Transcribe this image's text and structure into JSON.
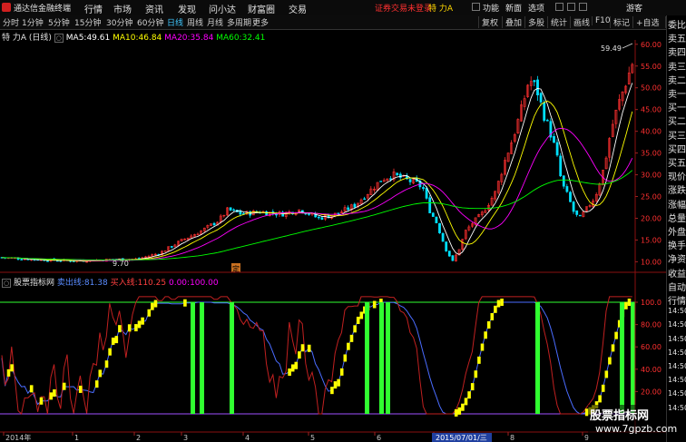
{
  "menubar": {
    "app_title": "通达信金融终端",
    "menus": [
      "行情",
      "市场",
      "资讯",
      "发现",
      "问小达",
      "财富圈",
      "交易"
    ],
    "status": "证券交易未登录",
    "stock": "特 力A",
    "right_menus": [
      "功能",
      "新面",
      "选项",
      "游客"
    ]
  },
  "toolbar": {
    "periods": [
      "分时",
      "1分钟",
      "5分钟",
      "15分钟",
      "30分钟",
      "60分钟",
      "日线",
      "周线",
      "月线",
      "多周期",
      "更多"
    ],
    "active_period": "日线",
    "right_buttons": [
      "复权",
      "叠加",
      "多股",
      "统计",
      "画线",
      "F10",
      "标记",
      "+自选",
      "返回"
    ]
  },
  "price_panel": {
    "title": "特 力A (日线)",
    "ma": [
      {
        "label": "MA5:",
        "value": "49.61",
        "color": "#ffffff"
      },
      {
        "label": "MA10:",
        "value": "46.84",
        "color": "#ffff00"
      },
      {
        "label": "MA20:",
        "value": "35.84",
        "color": "#ff00ff"
      },
      {
        "label": "MA60:",
        "value": "32.41",
        "color": "#00ff00"
      }
    ],
    "high_label": "59.49",
    "low_label": "9.70",
    "marker": "定",
    "y_ticks": [
      "60.00",
      "55.00",
      "50.00",
      "45.00",
      "40.00",
      "35.00",
      "30.00",
      "25.00",
      "20.00",
      "15.00",
      "10.00"
    ]
  },
  "indicator_panel": {
    "name": "股票指标网",
    "items": [
      {
        "label": "卖出线:",
        "value": "81.38",
        "color": "#5a8cff"
      },
      {
        "label": "买入线:",
        "value": "110.25",
        "color": "#ff4040"
      },
      {
        "label": "",
        "value": "0.00",
        "color": "#ff00ff"
      },
      {
        "label": "",
        "value": "100.00",
        "color": "#ff00ff"
      }
    ],
    "y_ticks": [
      "100.0",
      "80.00",
      "60.00",
      "40.00",
      "20.00"
    ]
  },
  "xaxis": {
    "labels": [
      "2014年",
      "1",
      "2",
      "3",
      "4",
      "5",
      "6",
      "2015/07/01/三",
      "8",
      "9"
    ]
  },
  "right_panel": {
    "tabs": [
      "委比",
      "卖五",
      "卖四",
      "卖三",
      "卖二",
      "卖一",
      "买一",
      "买二",
      "买三",
      "买四",
      "买五",
      "现价",
      "涨跌",
      "涨幅",
      "总量",
      "外盘",
      "换手",
      "净资",
      "收益",
      "自动",
      "行情",
      "14:50",
      "14:50",
      "14:50",
      "14:50",
      "14:50",
      "14:50",
      "14:50",
      "14:50"
    ]
  },
  "watermark": {
    "line1": "股票指标网",
    "line2": "www.7gpzb.com"
  },
  "chart_data": [
    {
      "type": "candlestick",
      "title": "特 力A (日线)",
      "ylim": [
        8,
        61
      ],
      "x": [
        "2014-01",
        "2014-02",
        "2014-03",
        "2014-04",
        "2014-05",
        "2014-06",
        "2015-07",
        "2015-08",
        "2015-09"
      ],
      "close_path": [
        [
          0,
          11
        ],
        [
          40,
          10.5
        ],
        [
          80,
          10.2
        ],
        [
          120,
          10.5
        ],
        [
          150,
          10.6
        ],
        [
          175,
          12
        ],
        [
          200,
          15
        ],
        [
          220,
          17
        ],
        [
          240,
          19.5
        ],
        [
          250,
          22
        ],
        [
          265,
          21
        ],
        [
          285,
          21.5
        ],
        [
          310,
          21
        ],
        [
          330,
          22
        ],
        [
          350,
          20
        ],
        [
          370,
          21
        ],
        [
          390,
          23
        ],
        [
          405,
          26
        ],
        [
          420,
          29
        ],
        [
          432,
          30
        ],
        [
          445,
          29
        ],
        [
          458,
          28
        ],
        [
          465,
          27
        ],
        [
          472,
          22
        ],
        [
          480,
          19
        ],
        [
          490,
          13
        ],
        [
          498,
          10
        ],
        [
          505,
          13
        ],
        [
          512,
          17
        ],
        [
          520,
          19
        ],
        [
          530,
          21
        ],
        [
          545,
          26
        ],
        [
          555,
          33
        ],
        [
          565,
          39
        ],
        [
          575,
          46
        ],
        [
          582,
          52
        ],
        [
          590,
          50
        ],
        [
          598,
          44
        ],
        [
          605,
          40
        ],
        [
          612,
          35
        ],
        [
          618,
          28
        ],
        [
          625,
          25
        ],
        [
          632,
          21
        ],
        [
          638,
          20
        ],
        [
          645,
          22
        ],
        [
          655,
          25
        ],
        [
          665,
          32
        ],
        [
          672,
          40
        ],
        [
          680,
          46
        ],
        [
          690,
          52
        ],
        [
          698,
          57
        ]
      ],
      "ma_series": [
        {
          "name": "MA5",
          "values": "49.61"
        },
        {
          "name": "MA10",
          "values": "46.84"
        },
        {
          "name": "MA20",
          "values": "35.84"
        },
        {
          "name": "MA60",
          "values": "32.41"
        }
      ]
    },
    {
      "type": "line",
      "ylim": [
        0,
        100
      ],
      "series": [
        {
          "name": "卖出线",
          "color": "#5a8cff"
        },
        {
          "name": "买入线",
          "color": "#ff4040"
        }
      ],
      "green_bars_x": [
        210,
        220,
        253,
        402,
        418,
        425,
        590,
        683,
        695
      ]
    }
  ],
  "colors": {
    "up": "#ff3030",
    "down": "#00e0ff",
    "ma5": "#ffffff",
    "ma10": "#ffff00",
    "ma20": "#ff00ff",
    "ma60": "#00ff00",
    "yellow_blocks": "#ffff00",
    "green_bars": "#30ff30"
  }
}
